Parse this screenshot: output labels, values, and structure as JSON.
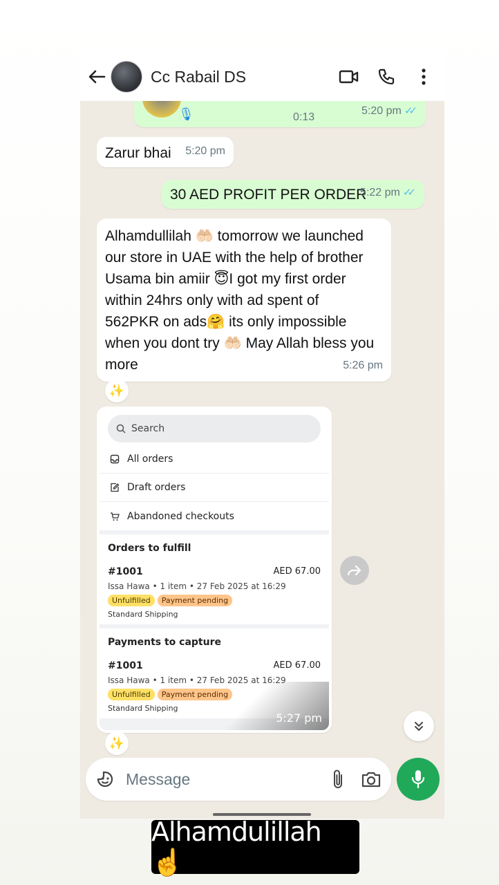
{
  "header": {
    "contact_name": "Cc Rabail DS"
  },
  "messages": {
    "voice": {
      "duration": "0:13",
      "time": "5:20 pm"
    },
    "m2": {
      "text": "Zarur bhai",
      "time": "5:20 pm"
    },
    "m3": {
      "text": "30 AED PROFIT PER ORDER",
      "time": "5:22 pm"
    },
    "m4": {
      "lines": [
        "Alhamdullilah 🤲🏻 tomorrow we launched",
        "our store in UAE with the help of brother",
        "Usama bin amiir 😇I got my first order",
        "within 24hrs only with ad spent of",
        "562PKR on ads🤗 its only impossible",
        "when you dont try 🤲🏻 May Allah bless you",
        "more"
      ],
      "time": "5:26 pm"
    },
    "image_time": "5:27 pm"
  },
  "store_screenshot": {
    "search_placeholder": "Search",
    "menu": [
      "All orders",
      "Draft orders",
      "Abandoned checkouts"
    ],
    "cards": [
      {
        "title": "Orders to fulfill",
        "order": "#1001",
        "amount": "AED 67.00",
        "meta": "Issa Hawa • 1 item • 27 Feb 2025 at 16:29",
        "badge1": "Unfulfilled",
        "badge2": "Payment pending",
        "shipping": "Standard Shipping"
      },
      {
        "title": "Payments to capture",
        "order": "#1001",
        "amount": "AED 67.00",
        "meta": "Issa Hawa • 1 item • 27 Feb 2025 at 16:29",
        "badge1": "Unfulfilled",
        "badge2": "Payment pending",
        "shipping": "Standard Shipping"
      }
    ]
  },
  "composer": {
    "placeholder": "Message"
  },
  "caption": "Alhamdulillah ☝️",
  "icons": {
    "sparkle": "✨",
    "forward": "forward-icon",
    "scroll_down": "chevrons-down-icon"
  },
  "colors": {
    "outgoing_bubble": "#d9fdd3",
    "incoming_bubble": "#ffffff",
    "chat_background": "#efeae2",
    "mic_button": "#21a95a",
    "read_ticks": "#53bdeb"
  }
}
